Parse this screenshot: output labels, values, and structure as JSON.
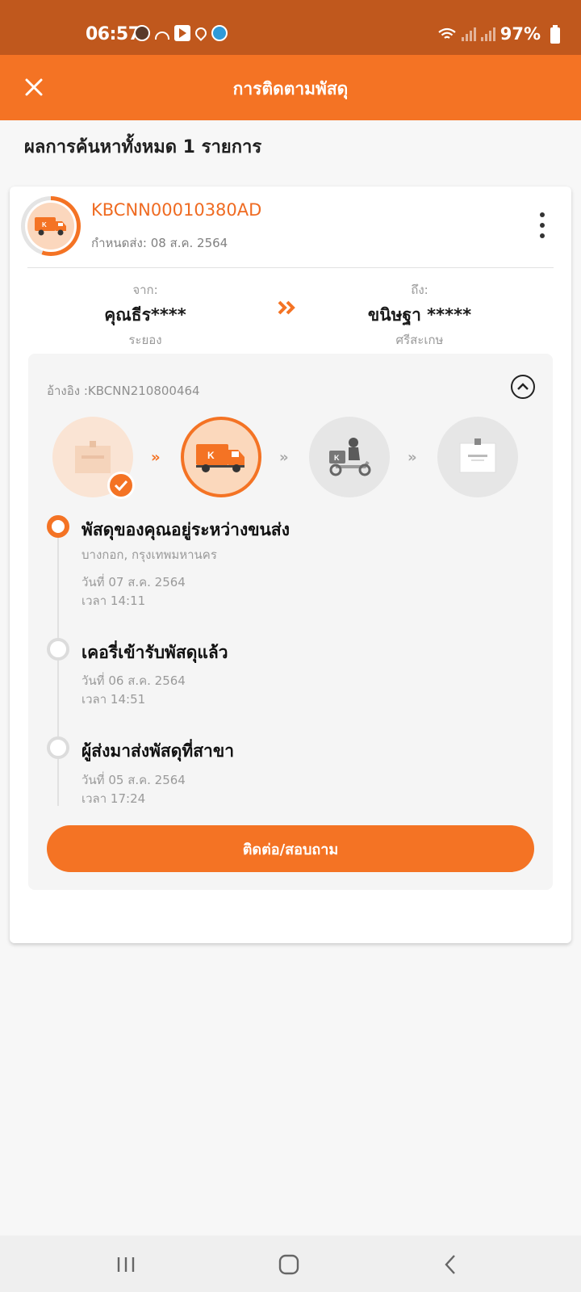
{
  "status_bar": {
    "time": "06:57",
    "battery": "97%"
  },
  "app_bar": {
    "title": "การติดตามพัสดุ"
  },
  "results": {
    "count_text": "ผลการค้นหาทั้งหมด 1 รายการ"
  },
  "parcel": {
    "tracking_no": "KBCNN00010380AD",
    "due_date": "กำหนดส่ง: 08 ส.ค. 2564",
    "from": {
      "label": "จาก:",
      "name": "คุณธีร****",
      "location": "ระยอง"
    },
    "to": {
      "label": "ถึง:",
      "name": "ขนิษฐา *****",
      "location": "ศรีสะเกษ"
    },
    "reference": "อ้างอิง :KBCNN210800464",
    "progress_stage": 2,
    "stages_total": 4,
    "events": [
      {
        "title": "พัสดุของคุณอยู่ระหว่างขนส่ง",
        "location": "บางกอก, กรุงเทพมหานคร",
        "date": "วันที่ 07 ส.ค. 2564",
        "time": "เวลา 14:11",
        "active": true
      },
      {
        "title": "เคอรี่เข้ารับพัสดุแล้ว",
        "date": "วันที่ 06 ส.ค. 2564",
        "time": "เวลา 14:51",
        "active": false
      },
      {
        "title": "ผู้ส่งมาส่งพัสดุที่สาขา",
        "date": "วันที่ 05 ส.ค. 2564",
        "time": "เวลา 17:24",
        "active": false
      }
    ],
    "contact_button": "ติดต่อ/สอบถาม"
  },
  "colors": {
    "brand": "#f47324",
    "status_bar": "#c0581d",
    "text_muted": "#999999"
  },
  "icons": [
    "close-icon",
    "more-vert-icon",
    "double-chevron-right-icon",
    "chevron-up-icon",
    "truck-icon",
    "box-icon",
    "scooter-icon",
    "check-icon"
  ]
}
